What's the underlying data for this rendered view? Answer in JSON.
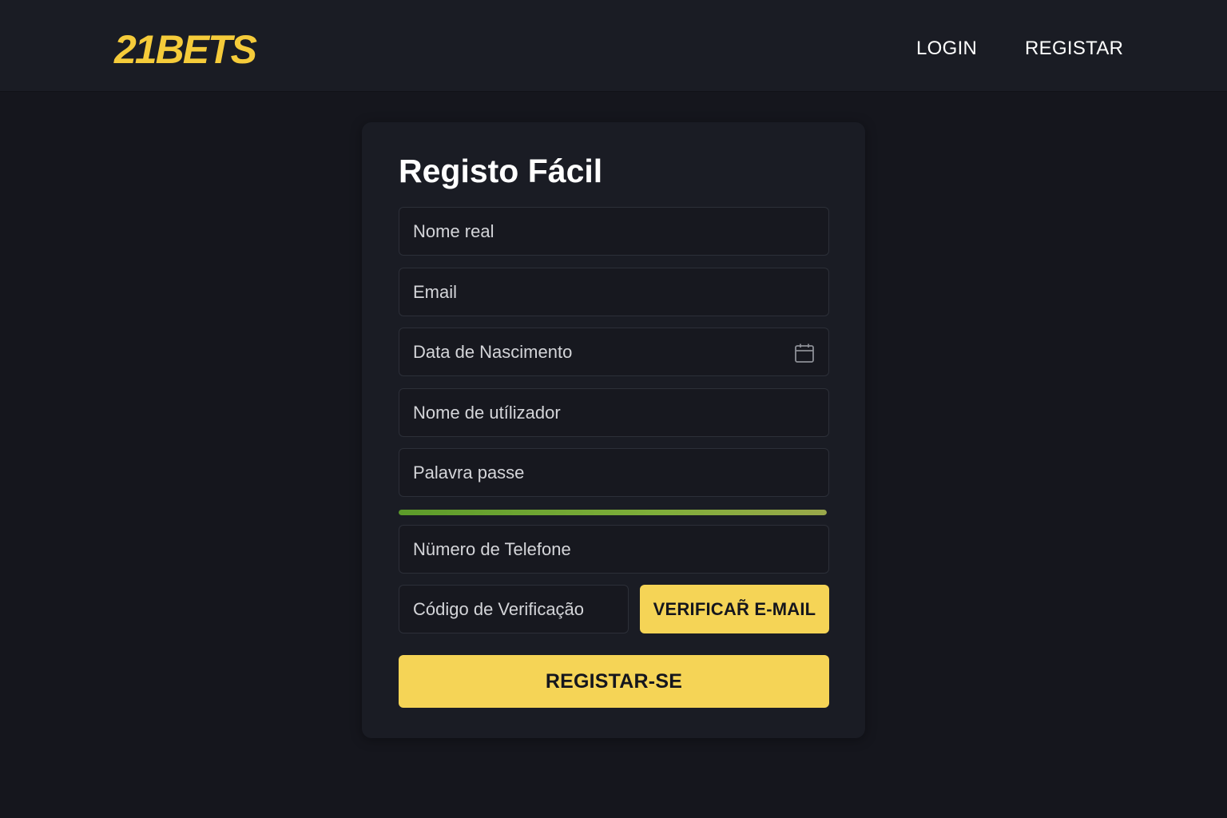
{
  "header": {
    "logo_text": "21BETS",
    "brand_color": "#f5cb3a",
    "nav": {
      "login_label": "LOGIN",
      "register_label": "REGISTAR"
    }
  },
  "form": {
    "title": "Registo Fácil",
    "fields": {
      "real_name": {
        "placeholder": "Nome real",
        "value": ""
      },
      "email": {
        "placeholder": "Email",
        "value": ""
      },
      "birth_date": {
        "placeholder": "Data de Nascimento",
        "value": "",
        "icon": "calendar-icon"
      },
      "username": {
        "placeholder": "Nome de utílizador",
        "value": ""
      },
      "password": {
        "placeholder": "Palavra passe",
        "value": ""
      },
      "phone": {
        "placeholder": "Nümero de Telefone",
        "value": ""
      },
      "verification_code": {
        "placeholder": "Código de Verificação",
        "value": ""
      }
    },
    "password_strength": {
      "level": 1.0,
      "color": "#7fae3a"
    },
    "verify_email_label": "VERIFICAR̃ E-MAIL",
    "submit_label": "REGISTAR-SE",
    "accent_color": "#f5d456"
  }
}
